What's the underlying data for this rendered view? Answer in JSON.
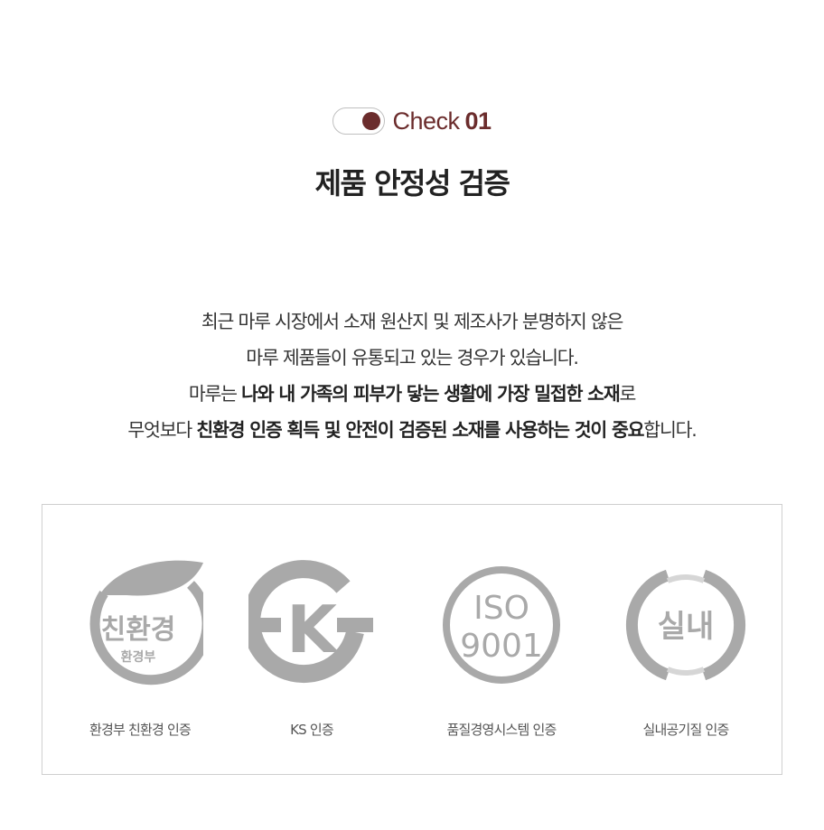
{
  "colors": {
    "accent": "#6b2c2c",
    "icon_gray": "#a9a9a9",
    "border": "#cfcfcf"
  },
  "badge": {
    "prefix": "Check",
    "number": "01"
  },
  "title": "제품 안정성 검증",
  "description": {
    "line1": "최근 마루 시장에서 소재 원산지 및 제조사가 분명하지 않은",
    "line2": "마루 제품들이 유통되고 있는 경우가 있습니다.",
    "line3": {
      "pre": "마루는 ",
      "bold": "나와 내 가족의 피부가 닿는 생활에 가장 밀접한 소재",
      "post": "로"
    },
    "line4": {
      "pre": "무엇보다 ",
      "bold": "친환경 인증 획득 및 안전이 검증된 소재를 사용하는 것이 중요",
      "post": "합니다."
    }
  },
  "certifications": [
    {
      "icon": "eco-label-icon",
      "icon_text_main": "친환경",
      "icon_text_sub": "환경부",
      "label": "환경부 친환경 인증"
    },
    {
      "icon": "ks-mark-icon",
      "icon_text_main": "K",
      "label": "KS 인증"
    },
    {
      "icon": "iso-icon",
      "icon_text_main": "ISO",
      "icon_text_sub": "9001",
      "label": "품질경영시스템 인증"
    },
    {
      "icon": "indoor-air-icon",
      "icon_text_main": "실내",
      "label": "실내공기질 인증"
    }
  ]
}
